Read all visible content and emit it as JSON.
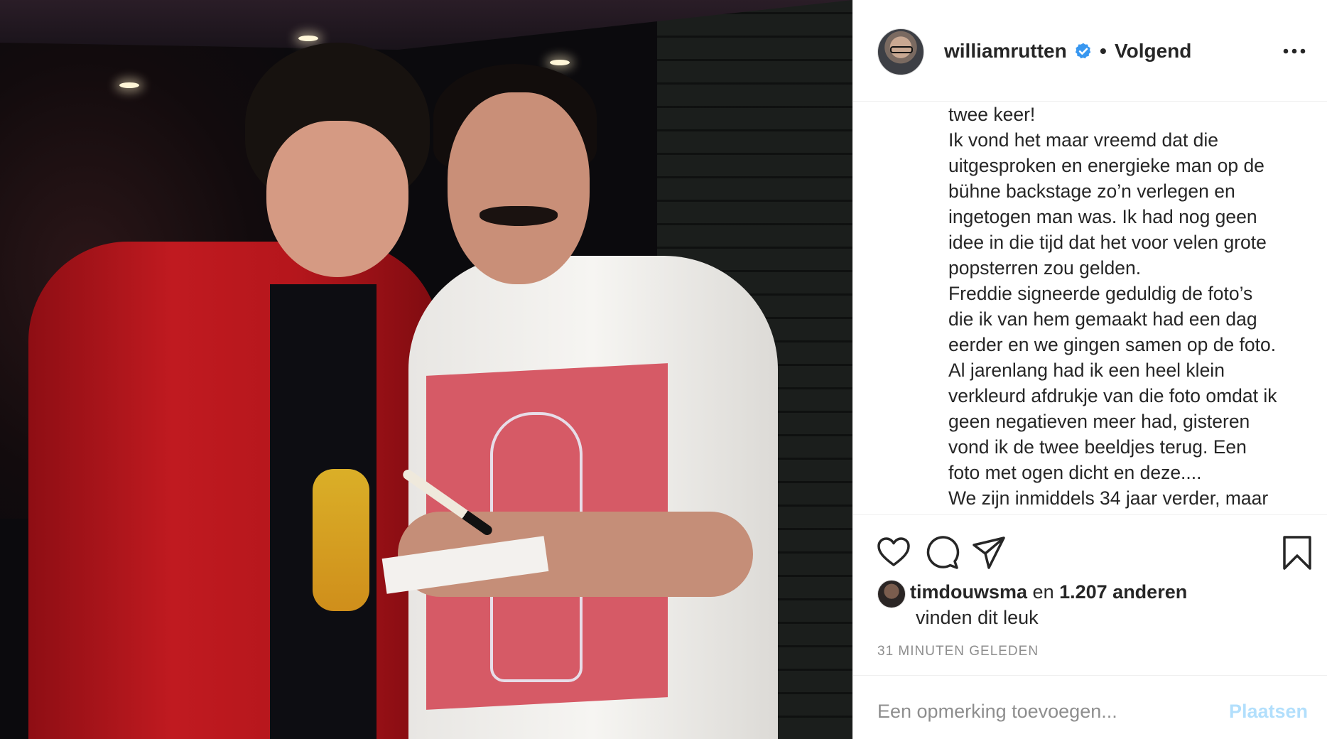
{
  "post": {
    "username": "williamrutten",
    "separator": "•",
    "follow_status": "Volgend",
    "caption_lines": [
      "twee keer!",
      "Ik vond het maar vreemd dat die",
      "uitgesproken en energieke man op de",
      "bühne backstage zo’n verlegen en",
      "ingetogen man was. Ik had nog geen",
      "idee in die tijd dat het voor velen grote",
      "popsterren zou gelden.",
      "Freddie signeerde geduldig de foto’s",
      "die ik van hem gemaakt had een dag",
      "eerder en we gingen samen op de foto.",
      "Al jarenlang had ik een heel klein",
      "verkleurd afdrukje van die foto omdat ik",
      "geen negatieven meer had, gisteren",
      "vond ik de twee beeldjes terug. Een",
      "foto met ogen dicht en deze....",
      "We zijn inmiddels 34 jaar verder, maar"
    ],
    "likes": {
      "liker": "timdouwsma",
      "connector": "en",
      "count": "1.207 anderen",
      "suffix": "vinden dit leuk"
    },
    "timestamp": "31 MINUTEN GELEDEN",
    "comment": {
      "placeholder": "Een opmerking toevoegen...",
      "post_label": "Plaatsen"
    }
  },
  "icons": {
    "verified": "verified-badge-icon",
    "more": "more-options-icon",
    "like": "heart-icon",
    "comment": "comment-icon",
    "share": "share-icon",
    "save": "bookmark-icon"
  },
  "colors": {
    "text": "#262626",
    "muted": "#8e8e8e",
    "verified": "#3897f0",
    "post_button_disabled": "#b2dffc",
    "divider": "#efefef"
  }
}
